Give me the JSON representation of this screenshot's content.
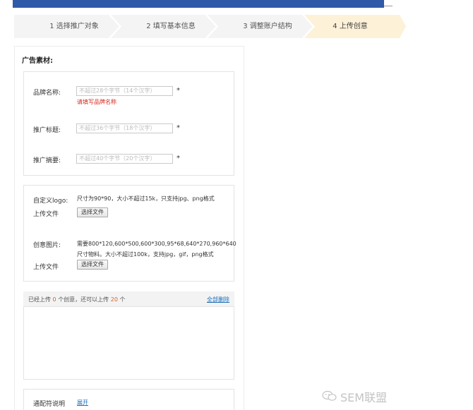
{
  "steps": [
    {
      "label": "1  选择推广对象",
      "active": false
    },
    {
      "label": "2  填写基本信息",
      "active": false
    },
    {
      "label": "3  调整账户结构",
      "active": false
    },
    {
      "label": "4  上传创意",
      "active": true
    }
  ],
  "colors": {
    "step_active": "#fdf1d7",
    "step_inactive": "#f4f4f4",
    "accent_link": "#1d6fb8",
    "error": "#d52b1e",
    "topbar": "#2f5aa8"
  },
  "ad_material": {
    "title": "广告素材:",
    "fields": [
      {
        "label": "品牌名称:",
        "placeholder": "不超过28个字节（14个汉字）",
        "required": "*",
        "error": "请填写品牌名称"
      },
      {
        "label": "推广标题:",
        "placeholder": "不超过36个字节（18个汉字）",
        "required": "*"
      },
      {
        "label": "推广摘要:",
        "placeholder": "不超过40个字节（20个汉字）",
        "required": "*"
      }
    ]
  },
  "logo": {
    "label": "自定义logo:",
    "desc": "尺寸为90*90，大小不超过15k，只支持jpg、png格式",
    "upload_label": "上传文件",
    "button": "选择文件"
  },
  "creative": {
    "label": "创意图片:",
    "desc1": "需要800*120,600*500,600*300,95*68,640*270,960*640",
    "desc2": "尺寸物料。大小不超过100k，支持jpg，gif，png格式",
    "upload_label": "上传文件",
    "button": "选择文件"
  },
  "upload_status": {
    "prefix": "已经上传",
    "uploaded": "0",
    "middle": "个创意，还可以上传",
    "remaining": "20",
    "suffix": "个",
    "delete_all": "全部删除"
  },
  "wildcard": {
    "label": "通配符说明",
    "expand": "展开"
  },
  "watermark": "SEM联盟"
}
